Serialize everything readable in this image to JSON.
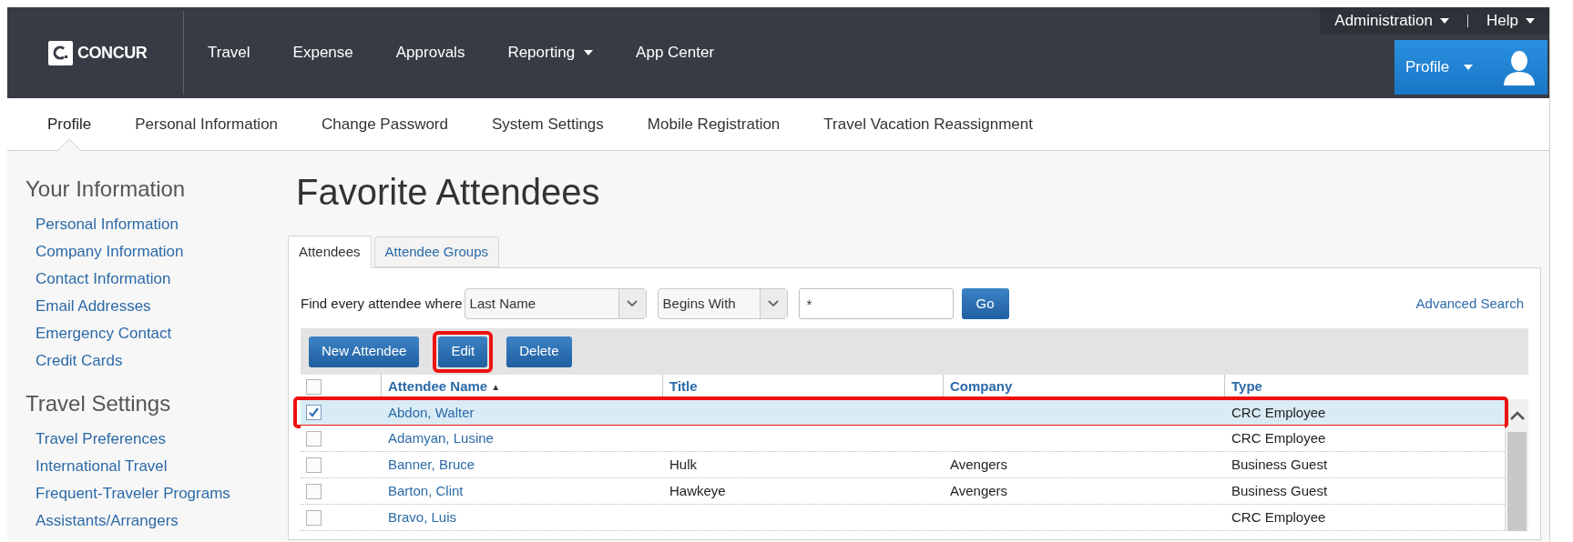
{
  "header": {
    "logo": "CONCUR",
    "nav": [
      {
        "label": "Travel",
        "dropdown": false
      },
      {
        "label": "Expense",
        "dropdown": false
      },
      {
        "label": "Approvals",
        "dropdown": false
      },
      {
        "label": "Reporting",
        "dropdown": true
      },
      {
        "label": "App Center",
        "dropdown": false
      }
    ],
    "utility": [
      {
        "label": "Administration"
      },
      {
        "label": "Help"
      }
    ],
    "profile_button": "Profile"
  },
  "subnav": [
    {
      "label": "Profile",
      "selected": true
    },
    {
      "label": "Personal Information",
      "selected": false
    },
    {
      "label": "Change Password",
      "selected": false
    },
    {
      "label": "System Settings",
      "selected": false
    },
    {
      "label": "Mobile Registration",
      "selected": false
    },
    {
      "label": "Travel Vacation Reassignment",
      "selected": false
    }
  ],
  "sidebar": [
    {
      "heading": "Your Information",
      "links": [
        "Personal Information",
        "Company Information",
        "Contact Information",
        "Email Addresses",
        "Emergency Contact",
        "Credit Cards"
      ]
    },
    {
      "heading": "Travel Settings",
      "links": [
        "Travel Preferences",
        "International Travel",
        "Frequent-Traveler Programs",
        "Assistants/Arrangers"
      ]
    }
  ],
  "page_title": "Favorite Attendees",
  "tabs": [
    {
      "label": "Attendees",
      "selected": true
    },
    {
      "label": "Attendee Groups",
      "selected": false
    }
  ],
  "search": {
    "label": "Find every attendee where",
    "field": "Last Name",
    "operator": "Begins With",
    "value": "*",
    "button": "Go",
    "advanced_link": "Advanced Search"
  },
  "toolbar": [
    {
      "label": "New Attendee",
      "highlighted": false
    },
    {
      "label": "Edit",
      "highlighted": true
    },
    {
      "label": "Delete",
      "highlighted": false
    }
  ],
  "table": {
    "all_checked": false,
    "columns": [
      {
        "label": "Attendee Name",
        "sort": "▲"
      },
      {
        "label": "Title"
      },
      {
        "label": "Company"
      },
      {
        "label": "Type"
      }
    ],
    "rows": [
      {
        "checked": true,
        "highlighted": true,
        "name": "Abdon, Walter",
        "title": "",
        "company": "",
        "type": "CRC Employee"
      },
      {
        "checked": false,
        "highlighted": false,
        "name": "Adamyan, Lusine",
        "title": "",
        "company": "",
        "type": "CRC Employee"
      },
      {
        "checked": false,
        "highlighted": false,
        "name": "Banner, Bruce",
        "title": "Hulk",
        "company": "Avengers",
        "type": "Business Guest"
      },
      {
        "checked": false,
        "highlighted": false,
        "name": "Barton, Clint",
        "title": "Hawkeye",
        "company": "Avengers",
        "type": "Business Guest"
      },
      {
        "checked": false,
        "highlighted": false,
        "name": "Bravo, Luis",
        "title": "",
        "company": "",
        "type": "CRC Employee"
      }
    ]
  }
}
